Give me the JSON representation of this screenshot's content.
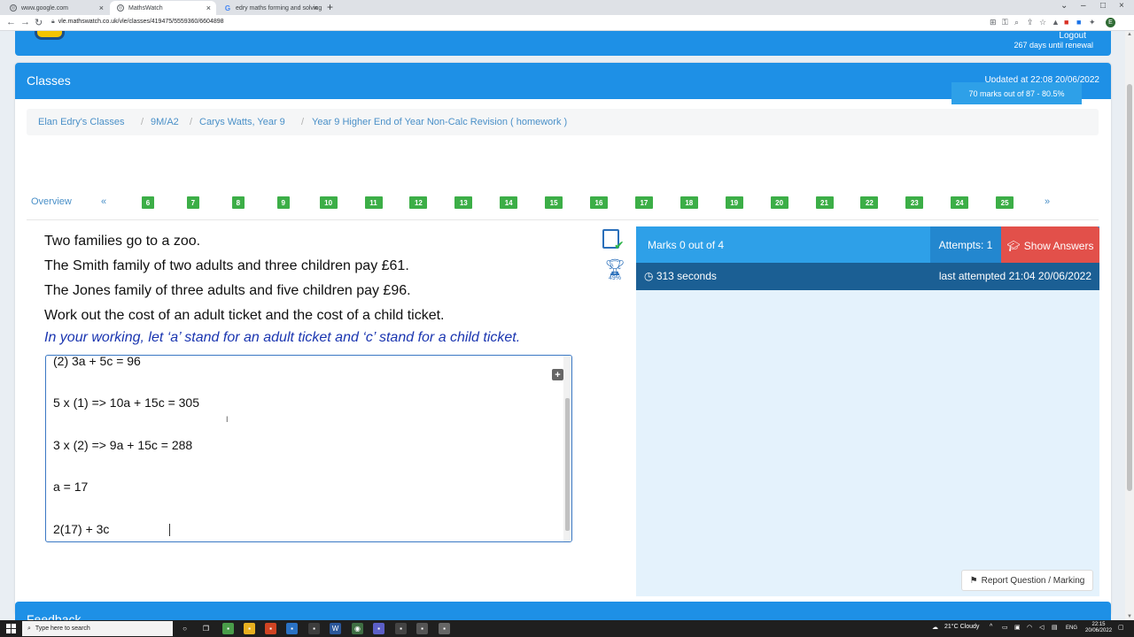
{
  "browser": {
    "tabs": [
      {
        "label": "www.google.com",
        "favicon": "globe-icon"
      },
      {
        "label": "MathsWatch",
        "favicon": "globe-icon"
      },
      {
        "label": "edry maths forming and solving",
        "favicon": "google-icon"
      }
    ],
    "url": "vle.mathswatch.co.uk/vle/classes/419475/5559360/6604898",
    "profile_initial": "E"
  },
  "header": {
    "logout": "Logout",
    "renewal": "267 days until renewal"
  },
  "card": {
    "title": "Classes",
    "updated": "Updated at 22:08 20/06/2022"
  },
  "breadcrumb": {
    "items": [
      "Elan Edry's Classes",
      "9M/A2",
      "Carys Watts, Year 9",
      "Year 9 Higher End of Year Non-Calc Revision ( homework )"
    ],
    "separator": "/"
  },
  "marks_badge": "70 marks out of 87 - 80.5%",
  "question_nav": {
    "overview": "Overview",
    "prev": "«",
    "next": "»",
    "numbers": [
      "6",
      "7",
      "8",
      "9",
      "10",
      "11",
      "12",
      "13",
      "14",
      "15",
      "16",
      "17",
      "18",
      "19",
      "20",
      "21",
      "22",
      "23",
      "24",
      "25"
    ],
    "color": "#3cae47"
  },
  "question": {
    "lines": [
      "Two families go to a zoo.",
      "The Smith family of two adults and three children pay £61.",
      "The Jones family of three adults and five children pay £96.",
      "Work out the cost of an adult ticket and the cost of a child ticket."
    ],
    "hint": "In your working, let ‘a’ stand for an adult ticket and ‘c’ stand for a child ticket."
  },
  "working": {
    "lines": [
      "(2) 3a + 5c = 96",
      "5 x (1) => 10a + 15c = 305",
      "3 x (2) => 9a + 15c = 288",
      "a = 17",
      "2(17) + 3c"
    ]
  },
  "tools": {
    "calculator": "calculator-icon",
    "trophy_percent": "49%"
  },
  "result_panel": {
    "marks": "Marks 0 out of 4",
    "attempts": "Attempts: 1",
    "show_answers": "Show Answers",
    "seconds": "313 seconds",
    "last_attempted": "last attempted 21:04 20/06/2022",
    "report": "Report Question / Marking"
  },
  "feedback": {
    "title": "Feedback"
  },
  "taskbar": {
    "search_placeholder": "Type here to search",
    "weather": "21°C Cloudy",
    "language": "ENG",
    "time": "22:15",
    "date": "20/06/2022"
  },
  "colors": {
    "brand_blue": "#1e90e6",
    "panel_dark": "#1b5f94",
    "danger": "#e2504a",
    "success": "#3cae47",
    "hint_blue": "#1a35b0"
  }
}
